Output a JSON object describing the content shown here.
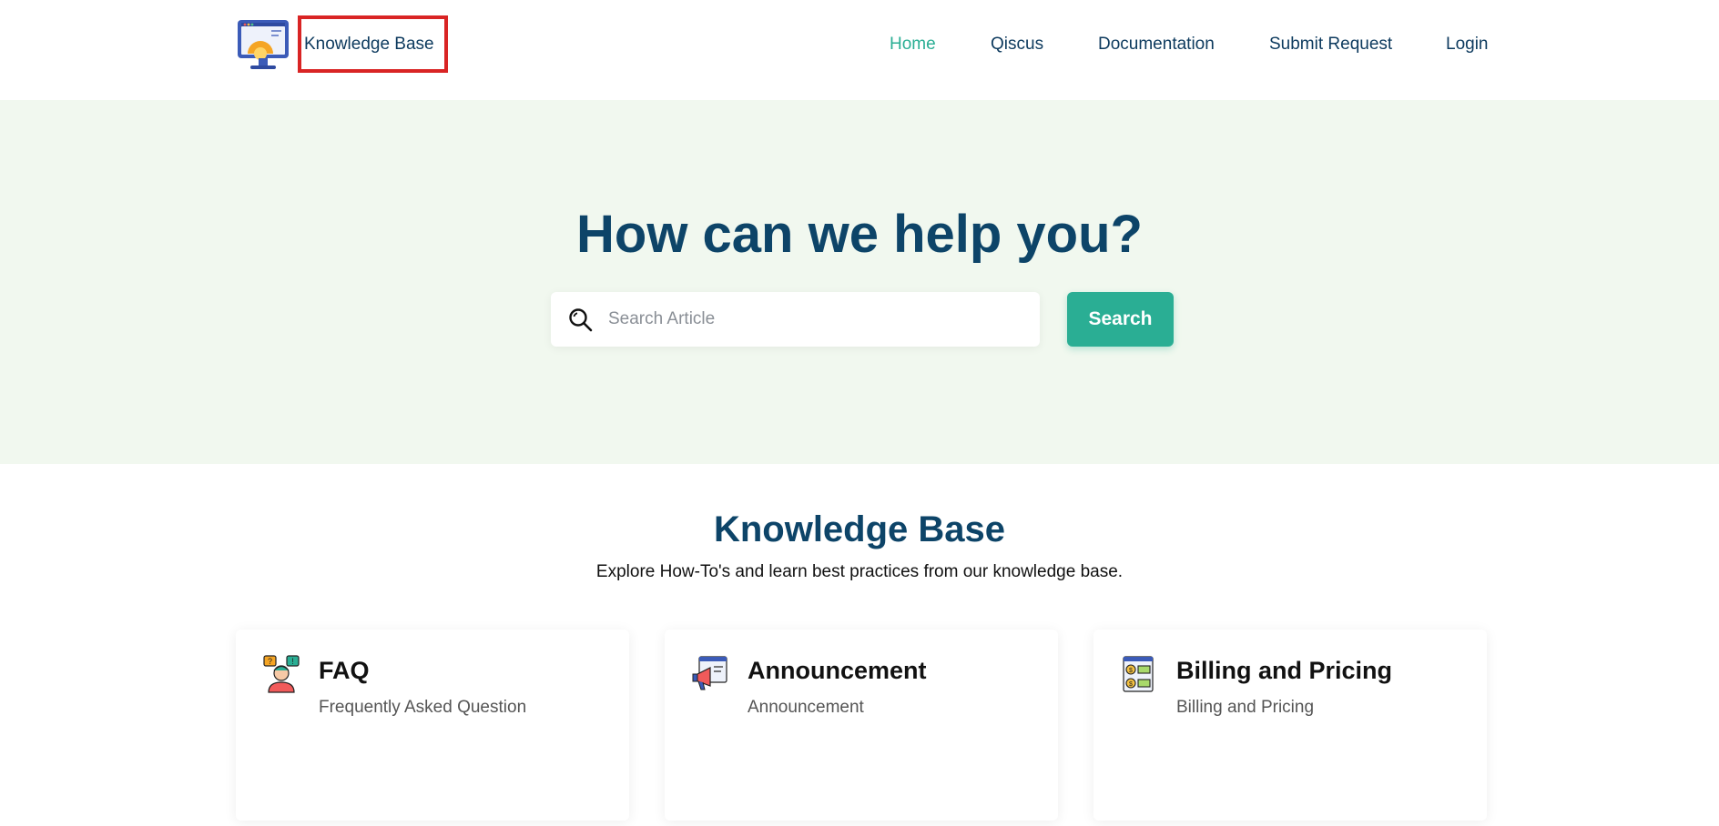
{
  "header": {
    "brand": "Knowledge Base",
    "nav": [
      {
        "label": "Home",
        "active": true
      },
      {
        "label": "Qiscus",
        "active": false
      },
      {
        "label": "Documentation",
        "active": false
      },
      {
        "label": "Submit Request",
        "active": false
      },
      {
        "label": "Login",
        "active": false
      }
    ]
  },
  "hero": {
    "title": "How can we help you?",
    "search_placeholder": "Search Article",
    "search_button": "Search"
  },
  "section": {
    "title": "Knowledge Base",
    "subtitle": "Explore How-To's and learn best practices from our knowledge base."
  },
  "cards": [
    {
      "icon": "faq-person-icon",
      "title": "FAQ",
      "description": "Frequently Asked Question"
    },
    {
      "icon": "megaphone-icon",
      "title": "Announcement",
      "description": "Announcement"
    },
    {
      "icon": "billing-document-icon",
      "title": "Billing and Pricing",
      "description": "Billing and Pricing"
    }
  ],
  "colors": {
    "primary": "#2aae94",
    "heading": "#0d4468",
    "nav": "#0d3a5e",
    "hero_bg": "#f1f8ef",
    "highlight": "#d92424"
  }
}
